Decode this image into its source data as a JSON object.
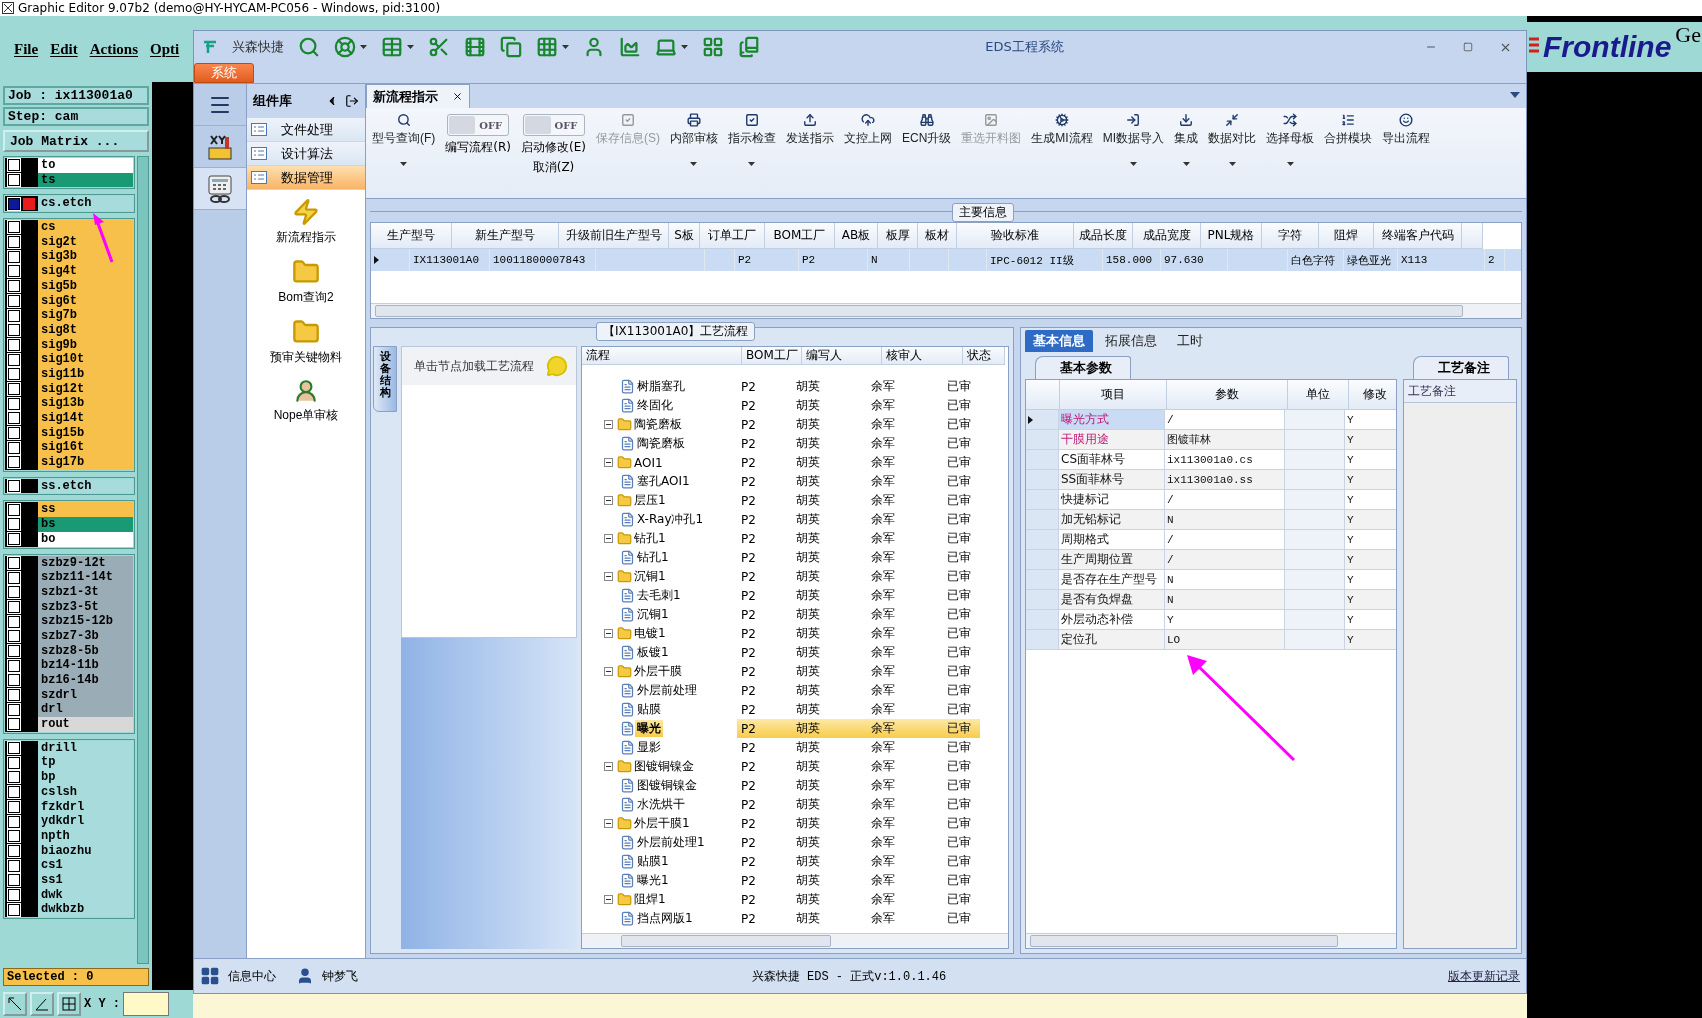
{
  "host_window": {
    "title": "Graphic Editor 9.07b2 (demo@HY-HYCAM-PC056 - Windows, pid:3100)"
  },
  "host_menu": [
    "File",
    "Edit",
    "Actions",
    "Opti"
  ],
  "job": {
    "job": "Job : ix113001a0",
    "step": "Step: cam",
    "matrix_button": "Job Matrix ..."
  },
  "layer_groups": [
    {
      "layers": [
        {
          "name": "to",
          "color": "#ffffff",
          "selected": false
        },
        {
          "name": "ts",
          "color": "#1a9a74",
          "selected": false
        }
      ]
    },
    {
      "layers": [
        {
          "name": "cs.etch",
          "color": "#a8dcdc",
          "selected": true
        }
      ]
    },
    {
      "layers": [
        {
          "name": "cs",
          "color": "#f7c04a",
          "selected": false
        },
        {
          "name": "sig2t",
          "color": "#f7c04a",
          "selected": false
        },
        {
          "name": "sig3b",
          "color": "#f7c04a",
          "selected": false
        },
        {
          "name": "sig4t",
          "color": "#f7c04a",
          "selected": false
        },
        {
          "name": "sig5b",
          "color": "#f7c04a",
          "selected": false
        },
        {
          "name": "sig6t",
          "color": "#f7c04a",
          "selected": false
        },
        {
          "name": "sig7b",
          "color": "#f7c04a",
          "selected": false
        },
        {
          "name": "sig8t",
          "color": "#f7c04a",
          "selected": false
        },
        {
          "name": "sig9b",
          "color": "#f7c04a",
          "selected": false
        },
        {
          "name": "sig10t",
          "color": "#f7c04a",
          "selected": false
        },
        {
          "name": "sig11b",
          "color": "#f7c04a",
          "selected": false
        },
        {
          "name": "sig12t",
          "color": "#f7c04a",
          "selected": false
        },
        {
          "name": "sig13b",
          "color": "#f7c04a",
          "selected": false
        },
        {
          "name": "sig14t",
          "color": "#f7c04a",
          "selected": false
        },
        {
          "name": "sig15b",
          "color": "#f7c04a",
          "selected": false
        },
        {
          "name": "sig16t",
          "color": "#f7c04a",
          "selected": false
        },
        {
          "name": "sig17b",
          "color": "#f7c04a",
          "selected": false
        }
      ]
    },
    {
      "layers": [
        {
          "name": "ss.etch",
          "color": "#a8dcdc",
          "selected": false
        }
      ]
    },
    {
      "layers": [
        {
          "name": "ss",
          "color": "#f7c04a",
          "selected": false
        },
        {
          "name": "bs",
          "color": "#1a9a74",
          "selected": false
        },
        {
          "name": "bo",
          "color": "#ffffff",
          "selected": false
        }
      ]
    },
    {
      "layers": [
        {
          "name": "szbz9-12t",
          "color": "#9aacb5",
          "selected": false
        },
        {
          "name": "szbz11-14t",
          "color": "#9aacb5",
          "selected": false
        },
        {
          "name": "szbz1-3t",
          "color": "#9aacb5",
          "selected": false
        },
        {
          "name": "szbz3-5t",
          "color": "#9aacb5",
          "selected": false
        },
        {
          "name": "szbz15-12b",
          "color": "#9aacb5",
          "selected": false
        },
        {
          "name": "szbz7-3b",
          "color": "#9aacb5",
          "selected": false
        },
        {
          "name": "szbz8-5b",
          "color": "#9aacb5",
          "selected": false
        },
        {
          "name": "bz14-11b",
          "color": "#9aacb5",
          "selected": false
        },
        {
          "name": "bz16-14b",
          "color": "#9aacb5",
          "selected": false
        },
        {
          "name": "szdrl",
          "color": "#9aacb5",
          "selected": false
        },
        {
          "name": "drl",
          "color": "#9aacb5",
          "selected": false
        },
        {
          "name": "rout",
          "color": "#d8d8d8",
          "selected": false
        }
      ]
    },
    {
      "layers": [
        {
          "name": "drill",
          "color": "#a8dcdc",
          "selected": false
        },
        {
          "name": "tp",
          "color": "#a8dcdc",
          "selected": false
        },
        {
          "name": "bp",
          "color": "#a8dcdc",
          "selected": false
        },
        {
          "name": "cslsh",
          "color": "#a8dcdc",
          "selected": false
        },
        {
          "name": "fzkdrl",
          "color": "#a8dcdc",
          "selected": false
        },
        {
          "name": "ydkdrl",
          "color": "#a8dcdc",
          "selected": false
        },
        {
          "name": "npth",
          "color": "#a8dcdc",
          "selected": false
        },
        {
          "name": "biaozhu",
          "color": "#a8dcdc",
          "selected": false
        },
        {
          "name": "cs1",
          "color": "#a8dcdc",
          "selected": false
        },
        {
          "name": "ss1",
          "color": "#a8dcdc",
          "selected": false
        },
        {
          "name": "dwk",
          "color": "#a8dcdc",
          "selected": false
        },
        {
          "name": "dwkbzb",
          "color": "#a8dcdc",
          "selected": false
        }
      ]
    }
  ],
  "selected_count": "Selected : 0",
  "xy_label": "X Y :",
  "logo": {
    "text": "Frontline",
    "extra": "Ge"
  },
  "window": {
    "brand": "兴森快捷",
    "title": "EDS工程系统",
    "system_tab": "系统"
  },
  "component_panel": {
    "title": "组件库",
    "categories": [
      {
        "label": "文件处理",
        "selected": false
      },
      {
        "label": "设计算法",
        "selected": false
      },
      {
        "label": "数据管理",
        "selected": true
      }
    ],
    "tools": [
      "新流程指示",
      "Bom查询2",
      "预审关键物料",
      "Nope单审核"
    ]
  },
  "doc_tabs": [
    {
      "label": "新流程指示",
      "selected": true
    }
  ],
  "ribbon": [
    {
      "kind": "button",
      "label": "型号查询(F)",
      "menu": true,
      "disabled": false
    },
    {
      "kind": "toggle",
      "label": "编写流程(R)",
      "state_text": "OFF",
      "on": false
    },
    {
      "kind": "toggle",
      "label": "启动修改(E)",
      "label2": "取消(Z)",
      "state_text": "OFF",
      "on": false
    },
    {
      "kind": "button",
      "label": "保存信息(S)",
      "menu": false,
      "disabled": true
    },
    {
      "kind": "button",
      "label": "内部审核",
      "menu": true,
      "disabled": false
    },
    {
      "kind": "button",
      "label": "指示检查",
      "menu": true,
      "disabled": false
    },
    {
      "kind": "button",
      "label": "发送指示",
      "menu": false,
      "disabled": false
    },
    {
      "kind": "button",
      "label": "文控上网",
      "menu": false,
      "disabled": false
    },
    {
      "kind": "button",
      "label": "ECN升级",
      "menu": false,
      "disabled": false
    },
    {
      "kind": "button",
      "label": "重选开料图",
      "menu": false,
      "disabled": true
    },
    {
      "kind": "button",
      "label": "生成MI流程",
      "menu": false,
      "disabled": false
    },
    {
      "kind": "button",
      "label": "MI数据导入",
      "menu": true,
      "disabled": false
    },
    {
      "kind": "button",
      "label": "集成",
      "menu": true,
      "disabled": false
    },
    {
      "kind": "button",
      "label": "数据对比",
      "menu": true,
      "disabled": false
    },
    {
      "kind": "button",
      "label": "选择母板",
      "menu": true,
      "disabled": false
    },
    {
      "kind": "button",
      "label": "合拼模块",
      "menu": false,
      "disabled": false
    },
    {
      "kind": "button",
      "label": "导出流程",
      "menu": false,
      "disabled": false
    }
  ],
  "main_info": {
    "title": "主要信息",
    "columns": [
      "生产型号",
      "新生产型号",
      "升级前旧生产型号",
      "S板",
      "订单工厂",
      "BOM工厂",
      "AB板",
      "板厚",
      "板材",
      "验收标准",
      "成品长度",
      "成品宽度",
      "PNL规格",
      "字符",
      "阻焊",
      "终端客户代码",
      ""
    ],
    "rows": [
      {
        "selected": true,
        "cells": [
          "IX113001A0",
          "10011800007843",
          "",
          "",
          "P2",
          "P2",
          "N",
          "",
          "",
          "IPC-6012 II级",
          "158.000",
          "97.630",
          "",
          "白色字符",
          "绿色亚光",
          "X113",
          "2"
        ]
      }
    ]
  },
  "process_panel": {
    "title": "【IX113001A0】工艺流程",
    "side_tab": "设备结构",
    "hint": "单击节点加载工艺流程",
    "columns": [
      "流程",
      "BOM工厂",
      "编写人",
      "核审人",
      "状态"
    ],
    "tree": [
      {
        "children": [
          {
            "label": "树脂塞孔",
            "bom": "P2",
            "writer": "胡英",
            "checker": "余军",
            "status": "已审",
            "selected": false
          },
          {
            "label": "终固化",
            "bom": "P2",
            "writer": "胡英",
            "checker": "余军",
            "status": "已审",
            "selected": false
          }
        ]
      },
      {
        "label": "陶瓷磨板",
        "bom": "P2",
        "writer": "胡英",
        "checker": "余军",
        "status": "已审",
        "selected": false,
        "expanded": true,
        "children": [
          {
            "label": "陶瓷磨板",
            "bom": "P2",
            "writer": "胡英",
            "checker": "余军",
            "status": "已审",
            "selected": false
          }
        ]
      },
      {
        "label": "AOI1",
        "bom": "P2",
        "writer": "胡英",
        "checker": "余军",
        "status": "已审",
        "selected": false,
        "expanded": true,
        "children": [
          {
            "label": "塞孔AOI1",
            "bom": "P2",
            "writer": "胡英",
            "checker": "余军",
            "status": "已审",
            "selected": false
          }
        ]
      },
      {
        "label": "层压1",
        "bom": "P2",
        "writer": "胡英",
        "checker": "余军",
        "status": "已审",
        "selected": false,
        "expanded": true,
        "children": [
          {
            "label": "X-Ray冲孔1",
            "bom": "P2",
            "writer": "胡英",
            "checker": "余军",
            "status": "已审",
            "selected": false
          }
        ]
      },
      {
        "label": "钻孔1",
        "bom": "P2",
        "writer": "胡英",
        "checker": "余军",
        "status": "已审",
        "selected": false,
        "expanded": true,
        "children": [
          {
            "label": "钻孔1",
            "bom": "P2",
            "writer": "胡英",
            "checker": "余军",
            "status": "已审",
            "selected": false
          }
        ]
      },
      {
        "label": "沉铜1",
        "bom": "P2",
        "writer": "胡英",
        "checker": "余军",
        "status": "已审",
        "selected": false,
        "expanded": true,
        "children": [
          {
            "label": "去毛刺1",
            "bom": "P2",
            "writer": "胡英",
            "checker": "余军",
            "status": "已审",
            "selected": false
          },
          {
            "label": "沉铜1",
            "bom": "P2",
            "writer": "胡英",
            "checker": "余军",
            "status": "已审",
            "selected": false
          }
        ]
      },
      {
        "label": "电镀1",
        "bom": "P2",
        "writer": "胡英",
        "checker": "余军",
        "status": "已审",
        "selected": false,
        "expanded": true,
        "children": [
          {
            "label": "板镀1",
            "bom": "P2",
            "writer": "胡英",
            "checker": "余军",
            "status": "已审",
            "selected": false
          }
        ]
      },
      {
        "label": "外层干膜",
        "bom": "P2",
        "writer": "胡英",
        "checker": "余军",
        "status": "已审",
        "selected": false,
        "expanded": true,
        "children": [
          {
            "label": "外层前处理",
            "bom": "P2",
            "writer": "胡英",
            "checker": "余军",
            "status": "已审",
            "selected": false
          },
          {
            "label": "贴膜",
            "bom": "P2",
            "writer": "胡英",
            "checker": "余军",
            "status": "已审",
            "selected": false
          },
          {
            "label": "曝光",
            "bom": "P2",
            "writer": "胡英",
            "checker": "余军",
            "status": "已审",
            "selected": true
          },
          {
            "label": "显影",
            "bom": "P2",
            "writer": "胡英",
            "checker": "余军",
            "status": "已审",
            "selected": false
          }
        ]
      },
      {
        "label": "图镀铜镍金",
        "bom": "P2",
        "writer": "胡英",
        "checker": "余军",
        "status": "已审",
        "selected": false,
        "expanded": true,
        "children": [
          {
            "label": "图镀铜镍金",
            "bom": "P2",
            "writer": "胡英",
            "checker": "余军",
            "status": "已审",
            "selected": false
          },
          {
            "label": "水洗烘干",
            "bom": "P2",
            "writer": "胡英",
            "checker": "余军",
            "status": "已审",
            "selected": false
          }
        ]
      },
      {
        "label": "外层干膜1",
        "bom": "P2",
        "writer": "胡英",
        "checker": "余军",
        "status": "已审",
        "selected": false,
        "expanded": true,
        "children": [
          {
            "label": "外层前处理1",
            "bom": "P2",
            "writer": "胡英",
            "checker": "余军",
            "status": "已审",
            "selected": false
          },
          {
            "label": "贴膜1",
            "bom": "P2",
            "writer": "胡英",
            "checker": "余军",
            "status": "已审",
            "selected": false
          },
          {
            "label": "曝光1",
            "bom": "P2",
            "writer": "胡英",
            "checker": "余军",
            "status": "已审",
            "selected": false
          }
        ]
      },
      {
        "label": "阻焊1",
        "bom": "P2",
        "writer": "胡英",
        "checker": "余军",
        "status": "已审",
        "selected": false,
        "expanded": true,
        "children": [
          {
            "label": "挡点网版1",
            "bom": "P2",
            "writer": "胡英",
            "checker": "余军",
            "status": "已审",
            "selected": false
          }
        ]
      }
    ]
  },
  "info_panel": {
    "tabs": [
      {
        "label": "基本信息",
        "selected": true
      },
      {
        "label": "拓展信息",
        "selected": false
      },
      {
        "label": "工时",
        "selected": false
      }
    ],
    "sub_tab": "基本参数",
    "columns": [
      "项目",
      "参数",
      "单位",
      "修改"
    ],
    "rows": [
      {
        "item": "曝光方式",
        "value": "/",
        "unit": "",
        "edit": "Y",
        "highlighted": true,
        "selected": true
      },
      {
        "item": "干膜用途",
        "value": "图镀菲林",
        "unit": "",
        "edit": "Y",
        "highlighted": true,
        "selected": false
      },
      {
        "item": "CS面菲林号",
        "value": "ix113001a0.cs",
        "unit": "",
        "edit": "Y",
        "highlighted": false,
        "selected": false
      },
      {
        "item": "SS面菲林号",
        "value": "ix113001a0.ss",
        "unit": "",
        "edit": "Y",
        "highlighted": false,
        "selected": false
      },
      {
        "item": "快捷标记",
        "value": "/",
        "unit": "",
        "edit": "Y",
        "highlighted": false,
        "selected": false
      },
      {
        "item": "加无铅标记",
        "value": "N",
        "unit": "",
        "edit": "Y",
        "highlighted": false,
        "selected": false
      },
      {
        "item": "周期格式",
        "value": "/",
        "unit": "",
        "edit": "Y",
        "highlighted": false,
        "selected": false
      },
      {
        "item": "生产周期位置",
        "value": "/",
        "unit": "",
        "edit": "Y",
        "highlighted": false,
        "selected": false
      },
      {
        "item": "是否存在生产型号",
        "value": "N",
        "unit": "",
        "edit": "Y",
        "highlighted": false,
        "selected": false
      },
      {
        "item": "是否有负焊盘",
        "value": "N",
        "unit": "",
        "edit": "Y",
        "highlighted": false,
        "selected": false
      },
      {
        "item": "外层动态补偿",
        "value": "Y",
        "unit": "",
        "edit": "Y",
        "highlighted": false,
        "selected": false
      },
      {
        "item": "定位孔",
        "value": "LO",
        "unit": "",
        "edit": "Y",
        "highlighted": false,
        "selected": false
      }
    ],
    "remarks_tab": "工艺备注",
    "remarks_header": "工艺备注"
  },
  "status_bar": {
    "info_center": "信息中心",
    "user": "钟梦飞",
    "version": "兴森快捷 EDS - 正式v:1.0.1.46",
    "changelog": "版本更新记录"
  }
}
